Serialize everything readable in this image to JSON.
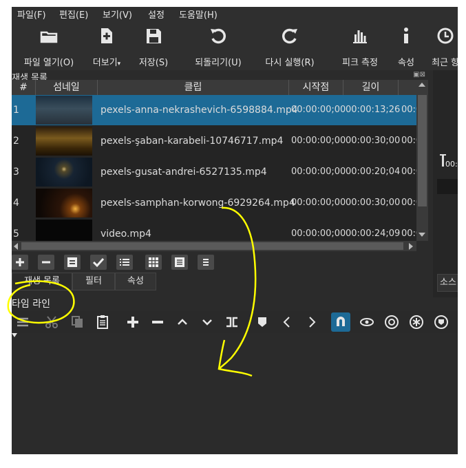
{
  "menu": [
    "파일(F)",
    "편집(E)",
    "보기(V)",
    "설정",
    "도움말(H)"
  ],
  "toolbar": [
    {
      "label": "파일 열기(O)",
      "icon": "folder-open-icon"
    },
    {
      "label": "더보기",
      "icon": "add-file-icon"
    },
    {
      "label": "저장(S)",
      "icon": "save-icon"
    },
    {
      "label": "되돌리기(U)",
      "icon": "undo-icon"
    },
    {
      "label": "다시 실행(R)",
      "icon": "redo-icon"
    },
    {
      "label": "피크 측정",
      "icon": "peak-meter-icon"
    },
    {
      "label": "속성",
      "icon": "info-icon"
    },
    {
      "label": "최근 항",
      "icon": "clock-icon"
    }
  ],
  "playlist": {
    "title": "재생 목록",
    "columns": [
      "#",
      "섬네일",
      "클립",
      "시작점",
      "길이"
    ],
    "rows": [
      {
        "n": "1",
        "clip": "pexels-anna-nekrashevich-6598884.mp4",
        "start": "00:00:00;00",
        "len": "00:00:13;26",
        "extra": "00:0"
      },
      {
        "n": "2",
        "clip": "pexels-şaban-karabeli-10746717.mp4",
        "start": "00:00:00;00",
        "len": "00:00:30;00",
        "extra": "00:0"
      },
      {
        "n": "3",
        "clip": "pexels-gusat-andrei-6527135.mp4",
        "start": "00:00:00;00",
        "len": "00:00:20;04",
        "extra": "00:0"
      },
      {
        "n": "4",
        "clip": "pexels-samphan-korwong-6929264.mp4",
        "start": "00:00:00;00",
        "len": "00:00:30;00",
        "extra": "00:0"
      },
      {
        "n": "5",
        "clip": "video.mp4",
        "start": "00:00:00;00",
        "len": "00:00:24;09",
        "extra": "00:0"
      }
    ]
  },
  "panel_tabs": [
    "재생 목록",
    "필터",
    "속성"
  ],
  "right_tab": "소스",
  "right_time": "00:",
  "timeline": {
    "title": "타임 라인"
  },
  "colors": {
    "selected": "#1d6a96",
    "annotation": "#ffff00",
    "snap": "#1d6a96"
  }
}
